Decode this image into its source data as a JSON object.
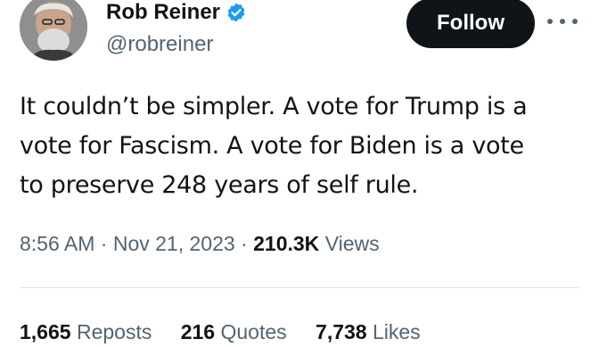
{
  "author": {
    "display_name": "Rob Reiner",
    "handle": "@robreiner",
    "verified_icon": "verified-badge-icon",
    "avatar": "profile-photo"
  },
  "actions": {
    "follow_label": "Follow",
    "more_icon": "more-options-icon"
  },
  "tweet": {
    "lines": [
      "It couldn’t be simpler. A vote for Trump is a",
      "vote for Fascism. A vote for Biden is a vote",
      "to preserve 248 years of self rule."
    ]
  },
  "meta": {
    "time": "8:56 AM",
    "separator": "·",
    "date": "Nov 21, 2023",
    "views_count": "210.3K",
    "views_label": "Views"
  },
  "stats": {
    "reposts_count": "1,665",
    "reposts_label": "Reposts",
    "quotes_count": "216",
    "quotes_label": "Quotes",
    "likes_count": "7,738",
    "likes_label": "Likes"
  },
  "colors": {
    "text": "#0f1419",
    "secondary": "#536471",
    "verified": "#1d9bf0",
    "button": "#0f1419"
  }
}
